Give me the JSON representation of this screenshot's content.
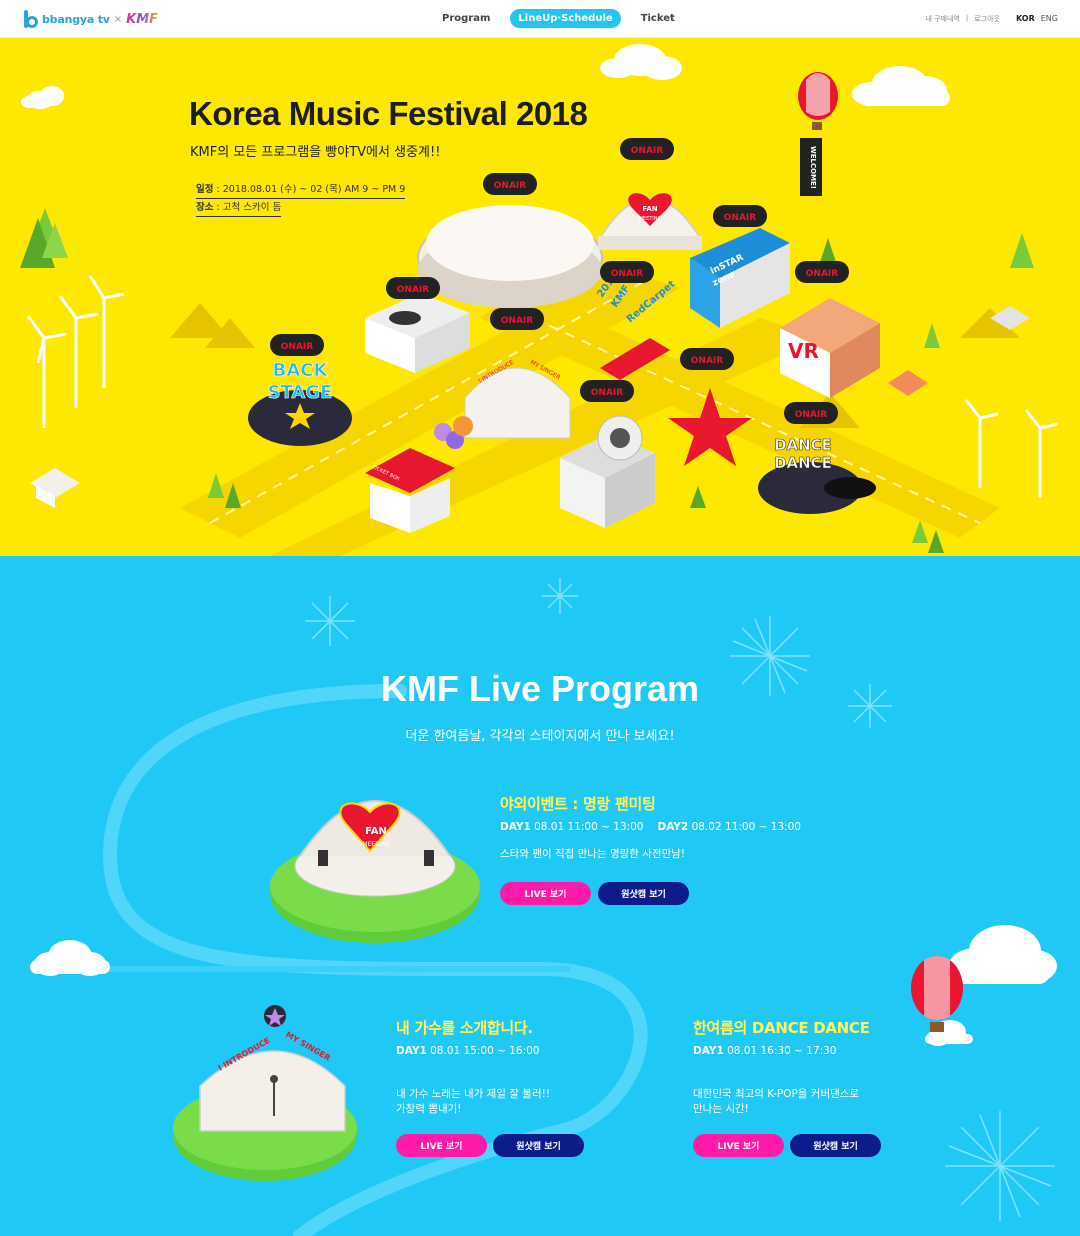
{
  "header": {
    "brand": "bbangya tv",
    "separator": "×",
    "partner": "KMF",
    "nav": [
      "Program",
      "LineUp·Schedule",
      "Ticket"
    ],
    "active_nav": "LineUp·Schedule",
    "util": [
      "내 구매내역",
      "|",
      "로그아웃"
    ],
    "lang": [
      "KOR",
      "ENG"
    ]
  },
  "hero": {
    "title": "Korea Music Festival 2018",
    "subtitle": "KMF의 모든 프로그램을 빵야TV에서 생중계!!",
    "schedule_label": "일정",
    "schedule_value": " : 2018.08.01 (수) ~ 02 (목)  AM 9 ~ PM 9",
    "place_label": "장소",
    "place_value": " : 고척 스카이 돔",
    "signs": [
      "BACK",
      "STAGE",
      "DANCE",
      "DANCE",
      "TICEKT",
      "TICKET BOX",
      "FAN",
      "MEETING",
      "inSTAR",
      "zone",
      "VR",
      "WELCOME!",
      "2018",
      "KMF",
      "RedCarpet",
      "I INTRODUCE",
      "MY SINGER",
      "ONAIR"
    ]
  },
  "live": {
    "title": "KMF Live Program",
    "subtitle": "더운 한여름날, 각각의 스테이지에서 만나 보세요!",
    "programs": [
      {
        "title": "야외이벤트 : 명랑 팬미팅",
        "days": [
          {
            "label": "DAY1",
            "time": "08.01 11:00 ~ 13:00"
          },
          {
            "label": "DAY2",
            "time": "08.02 11:00 ~ 13:00"
          }
        ],
        "desc": [
          "스타와 팬이 직접 만나는 명랑한 사전만남!"
        ],
        "live_btn": "LIVE 보기",
        "cam_btn": "원샷캠 보기",
        "stage_sign": [
          "FAN",
          "MEETING"
        ]
      },
      {
        "title": "내 가수를 소개합니다.",
        "days": [
          {
            "label": "DAY1",
            "time": "08.01 15:00 ~ 16:00"
          }
        ],
        "desc": [
          "내 가수 노래는 내가 제일 잘 불러!!",
          "가창력 뽐내기!"
        ],
        "live_btn": "LIVE 보기",
        "cam_btn": "원샷캠 보기",
        "stage_sign": [
          "I INTRODUCE",
          "MY SINGER"
        ]
      },
      {
        "title": "한여름의 DANCE DANCE",
        "days": [
          {
            "label": "DAY1",
            "time": "08.01 16:30 ~ 17:30"
          }
        ],
        "desc": [
          "대한민국 최고의 K-POP을 커버댄스로",
          "만나는 시간!"
        ],
        "live_btn": "LIVE 보기",
        "cam_btn": "원샷캠 보기"
      }
    ]
  },
  "colors": {
    "hero_bg": "#ffe800",
    "live_bg": "#20c8f6",
    "accent_pink": "#ff1aa8",
    "accent_navy": "#0c1c8a",
    "title_yellow": "#fff35a"
  }
}
